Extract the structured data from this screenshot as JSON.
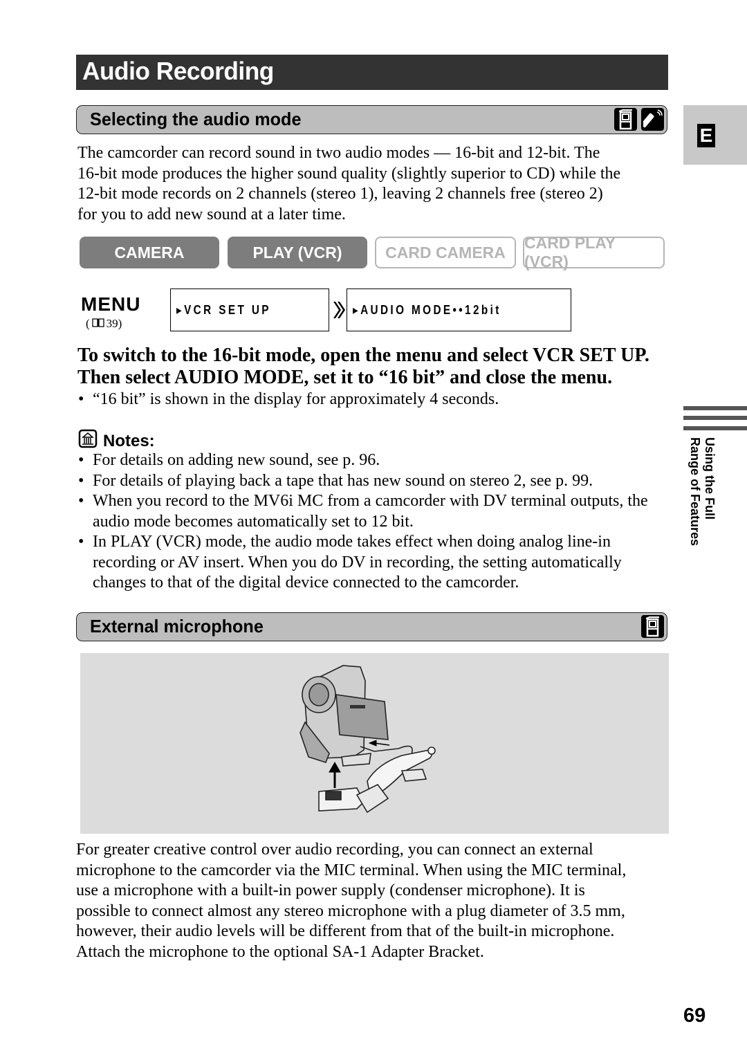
{
  "page_title": "Audio Recording",
  "side_tab": {
    "language_letter": "E",
    "chapter_line1": "Using the Full",
    "chapter_line2": "Range of Features"
  },
  "section1": {
    "heading": "Selecting the audio mode",
    "icons": [
      "camcorder-icon",
      "remote-control-icon"
    ],
    "intro_lines": [
      "The camcorder can record sound in two audio modes — 16-bit and 12-bit. The",
      "16-bit mode produces the higher sound quality (slightly superior to CD) while the",
      "12-bit mode records on 2 channels (stereo 1), leaving 2 channels free (stereo 2)",
      "for you to add new sound at a later time."
    ],
    "modes": [
      {
        "label": "CAMERA",
        "active": true
      },
      {
        "label": "PLAY (VCR)",
        "active": true
      },
      {
        "label": "CARD CAMERA",
        "active": false
      },
      {
        "label": "CARD PLAY (VCR)",
        "active": false
      }
    ],
    "menu": {
      "label": "MENU",
      "ref_open": "(",
      "ref_page": "39)",
      "step1": "▸VCR SET UP",
      "step2": "▸AUDIO MODE••12bit"
    },
    "instruction_line1": "To switch to the 16-bit mode, open the menu and select VCR SET UP.",
    "instruction_line2": "Then select AUDIO MODE, set it to “16 bit” and close the menu.",
    "instruction_bullet": "“16 bit” is shown in the display for approximately 4 seconds.",
    "notes_title": "Notes:",
    "notes": [
      "For details on adding new sound, see p. 96.",
      "For details of playing back a tape that has new sound on stereo 2, see p. 99.",
      "When you record to the MV6i MC from a camcorder with DV terminal outputs, the audio mode becomes automatically set to 12 bit.",
      "In PLAY (VCR) mode, the audio mode takes effect when doing analog line-in recording or AV insert. When you do DV in recording, the setting automatically changes to that of the digital device connected to the camcorder."
    ]
  },
  "section2": {
    "heading": "External microphone",
    "icons": [
      "camcorder-icon"
    ],
    "illustration": "camcorder-with-external-microphone-on-adapter-bracket",
    "body_lines": [
      "For greater creative control over audio recording, you can connect an external",
      "microphone to the camcorder via the MIC terminal. When using the MIC terminal,",
      "use a microphone with a built-in power supply (condenser microphone). It is",
      "possible to connect almost any stereo microphone with a plug diameter of 3.5 mm,",
      "however, their audio levels will be different from that of the built-in microphone.",
      "Attach the microphone to the optional SA-1 Adapter Bracket."
    ]
  },
  "page_number": "69"
}
